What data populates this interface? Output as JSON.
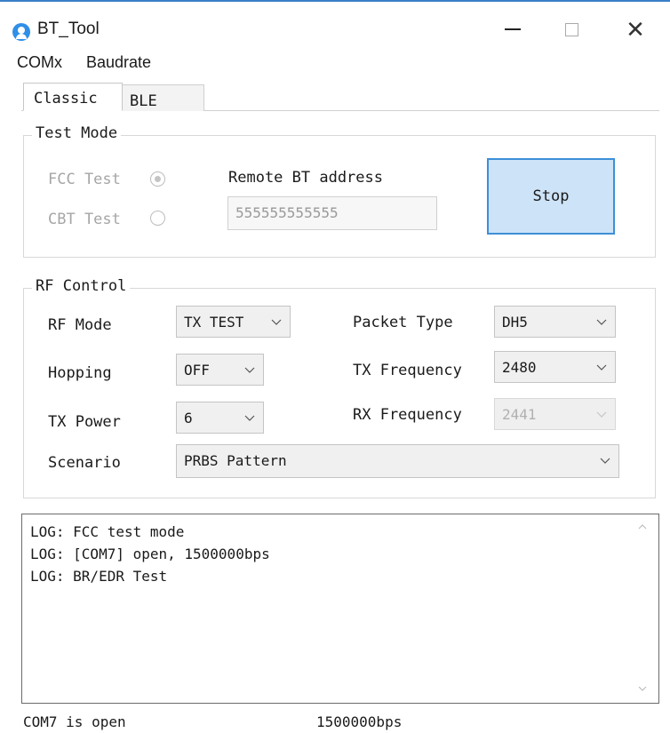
{
  "window": {
    "title": "BT_Tool",
    "accent_color": "#3a7fc8",
    "icon": "bluetooth-app-icon"
  },
  "menu": {
    "comx": "COMx",
    "baudrate": "Baudrate"
  },
  "tabs": {
    "classic": "Classic",
    "ble": "BLE",
    "active": "Classic"
  },
  "test_mode": {
    "legend": "Test Mode",
    "fcc_label": "FCC Test",
    "cbt_label": "CBT Test",
    "selected": "FCC Test",
    "remote_label": "Remote BT address",
    "remote_value": "555555555555",
    "stop_label": "Stop"
  },
  "rf_control": {
    "legend": "RF Control",
    "rf_mode_label": "RF Mode",
    "rf_mode_value": "TX TEST",
    "hopping_label": "Hopping",
    "hopping_value": "OFF",
    "tx_power_label": "TX Power",
    "tx_power_value": "6",
    "scenario_label": "Scenario",
    "scenario_value": "PRBS Pattern",
    "packet_type_label": "Packet Type",
    "packet_type_value": "DH5",
    "tx_freq_label": "TX Frequency",
    "tx_freq_value": "2480",
    "rx_freq_label": "RX Frequency",
    "rx_freq_value": "2441"
  },
  "log": [
    "LOG: FCC test mode",
    "LOG: [COM7] open, 1500000bps",
    "LOG: BR/EDR Test"
  ],
  "status": {
    "port": "COM7 is open",
    "baud": "1500000bps"
  },
  "colors": {
    "button_fill": "#cde3f7",
    "button_border": "#3d8fd6"
  }
}
